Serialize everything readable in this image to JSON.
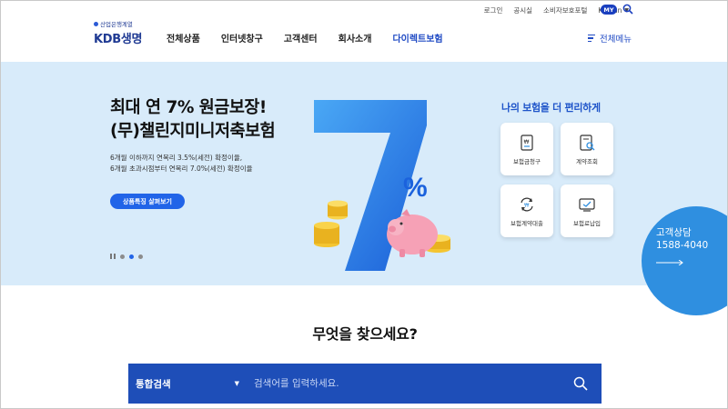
{
  "utility": {
    "login": "로그인",
    "notice": "공시실",
    "consumer": "소비자보호포털",
    "language": "Korean",
    "my": "MY"
  },
  "logo": {
    "subtitle": "산업은행계열",
    "name": "KDB생명"
  },
  "nav": {
    "items": [
      "전체상품",
      "인터넷창구",
      "고객센터",
      "회사소개",
      "다이렉트보험"
    ],
    "all_menu": "전체메뉴"
  },
  "hero": {
    "headline_1": "최대 연 7% 원금보장!",
    "headline_2": "(무)챌린지미니저축보험",
    "desc_1": "6개월 이하까지 연복리 3.5%(세전) 확정이율,",
    "desc_2": "6개월 초과시점부터 연복리 7.0%(세전) 확정이율",
    "cta": "상품특징 살펴보기",
    "big_number": "7",
    "percent": "%",
    "slide_count": 3,
    "active_slide": 2
  },
  "quick": {
    "title": "나의 보험을 더 편리하게",
    "items": [
      {
        "label": "보험금청구",
        "icon": "claim-document-icon"
      },
      {
        "label": "계약조회",
        "icon": "contract-search-icon"
      },
      {
        "label": "보험계약대출",
        "icon": "loan-exchange-icon"
      },
      {
        "label": "보험료납입",
        "icon": "premium-payment-icon"
      }
    ]
  },
  "consult": {
    "title": "고객상담",
    "phone": "1588-4040"
  },
  "search": {
    "heading": "무엇을 찾으세요?",
    "category": "통합검색",
    "placeholder": "검색어를 입력하세요."
  },
  "colors": {
    "brand_blue": "#1f4ac4",
    "hero_bg": "#d8ebfa",
    "search_bg": "#1e4eb8",
    "consult_bg": "#2f8fe0",
    "cta_bg": "#2164e8"
  }
}
